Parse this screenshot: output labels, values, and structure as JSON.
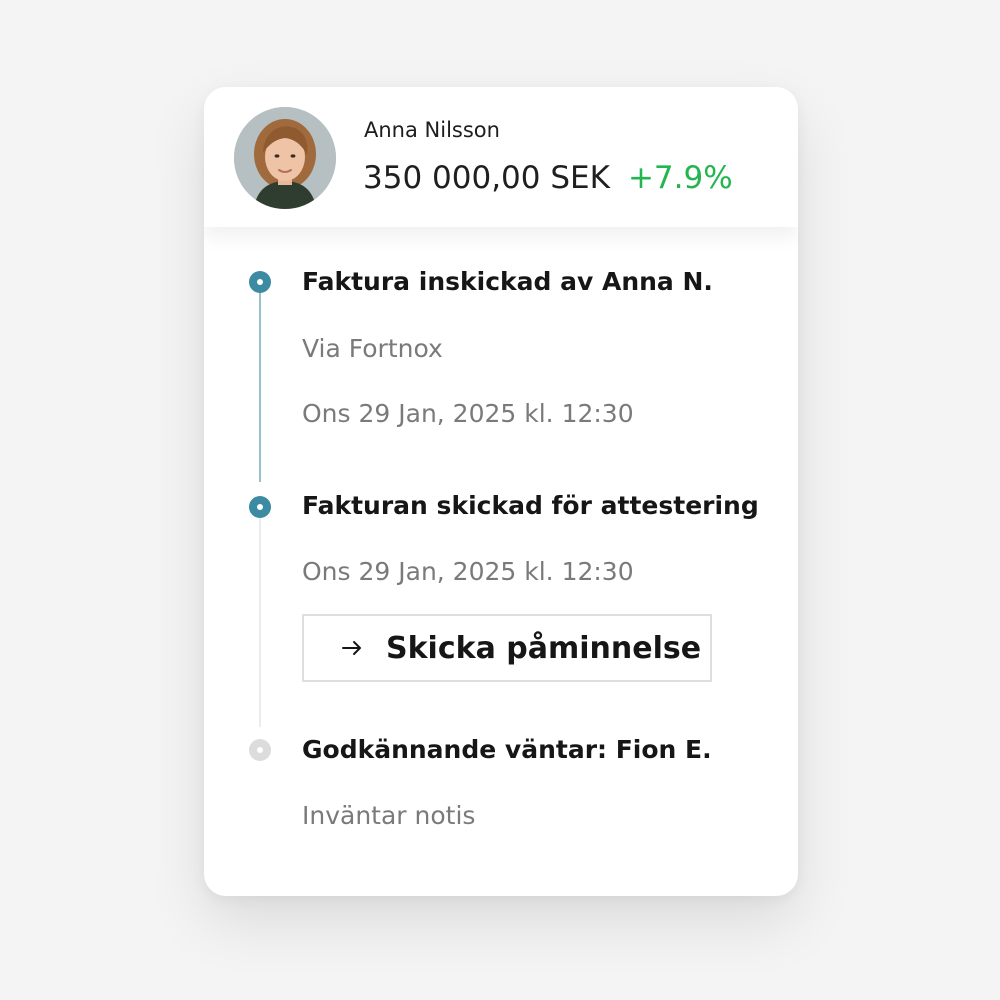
{
  "profile": {
    "name": "Anna Nilsson",
    "amount": "350 000,00 SEK",
    "change": "+7.9%"
  },
  "timeline": [
    {
      "title": "Faktura inskickad av Anna N.",
      "details": [
        "Via Fortnox",
        "Ons 29 Jan, 2025 kl. 12:30"
      ],
      "status": "done"
    },
    {
      "title": "Fakturan skickad för attestering",
      "details": [
        "Ons 29 Jan, 2025 kl. 12:30"
      ],
      "status": "done",
      "action_label": "Skicka påminnelse"
    },
    {
      "title": "Godkännande väntar: Fion E.",
      "details": [
        "Inväntar notis"
      ],
      "status": "pending"
    }
  ],
  "colors": {
    "accent": "#3d8aa3",
    "positive": "#22b550",
    "pending": "#dcdcdc"
  },
  "icons": {
    "avatar": "person-avatar",
    "action": "arrow-right-icon"
  }
}
